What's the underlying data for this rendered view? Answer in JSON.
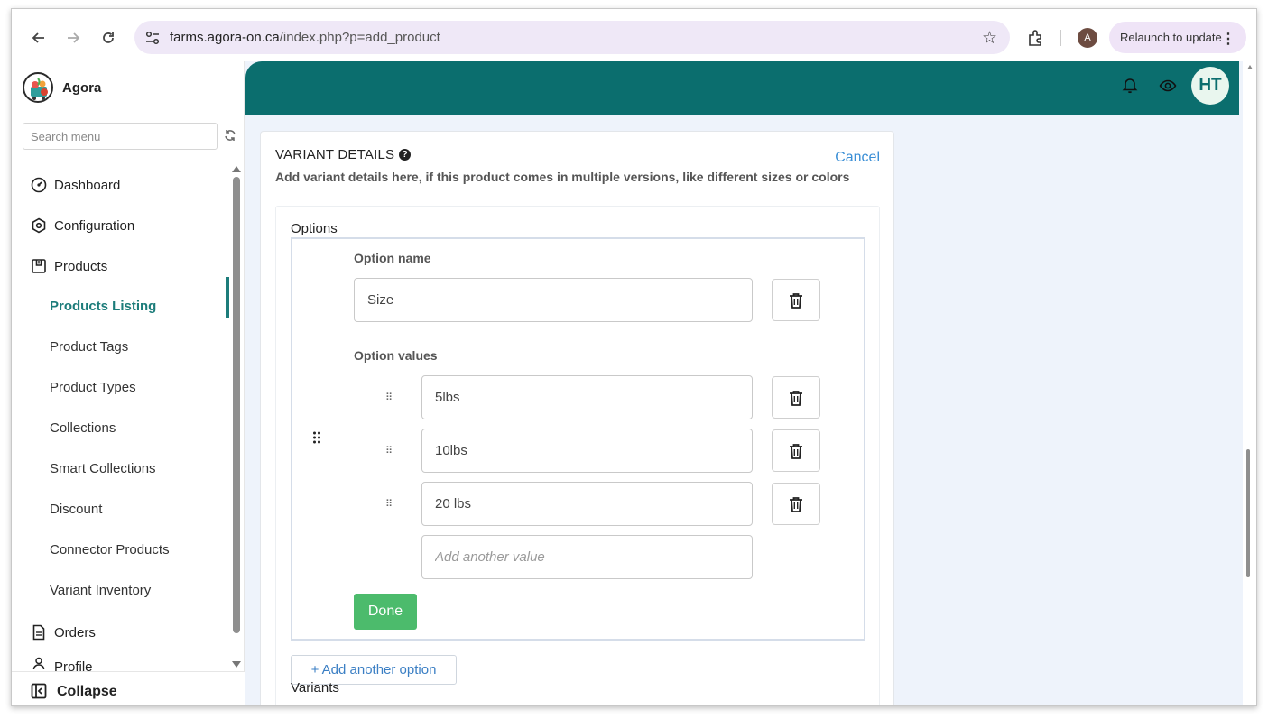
{
  "browser": {
    "url_host": "farms.agora-on.ca",
    "url_path": "/index.php?p=add_product",
    "profile_initial": "A",
    "relaunch_label": "Relaunch to update"
  },
  "sidebar": {
    "brand": "Agora",
    "search_placeholder": "Search menu",
    "items": [
      {
        "label": "Dashboard",
        "icon": "dashboard-icon"
      },
      {
        "label": "Configuration",
        "icon": "configuration-icon"
      },
      {
        "label": "Products",
        "icon": "products-icon"
      }
    ],
    "sub_items": [
      {
        "label": "Products Listing",
        "active": true
      },
      {
        "label": "Product Tags"
      },
      {
        "label": "Product Types"
      },
      {
        "label": "Collections"
      },
      {
        "label": "Smart Collections"
      },
      {
        "label": "Discount"
      },
      {
        "label": "Connector Products"
      },
      {
        "label": "Variant Inventory"
      }
    ],
    "orders_label": "Orders",
    "profile_label": "Profile",
    "collapse_label": "Collapse"
  },
  "header": {
    "user_initials": "HT",
    "bar_color": "#0b6e6e"
  },
  "variant_details": {
    "title": "VARIANT DETAILS",
    "description": "Add variant details here, if this product comes in multiple versions, like different sizes or colors",
    "cancel_label": "Cancel",
    "options_label": "Options",
    "option_name_label": "Option name",
    "option_name_value": "Size",
    "option_values_label": "Option values",
    "values": [
      "5lbs",
      "10lbs",
      "20 lbs"
    ],
    "add_value_placeholder": "Add another value",
    "done_label": "Done",
    "add_option_label": "+ Add another option",
    "variants_label": "Variants"
  }
}
